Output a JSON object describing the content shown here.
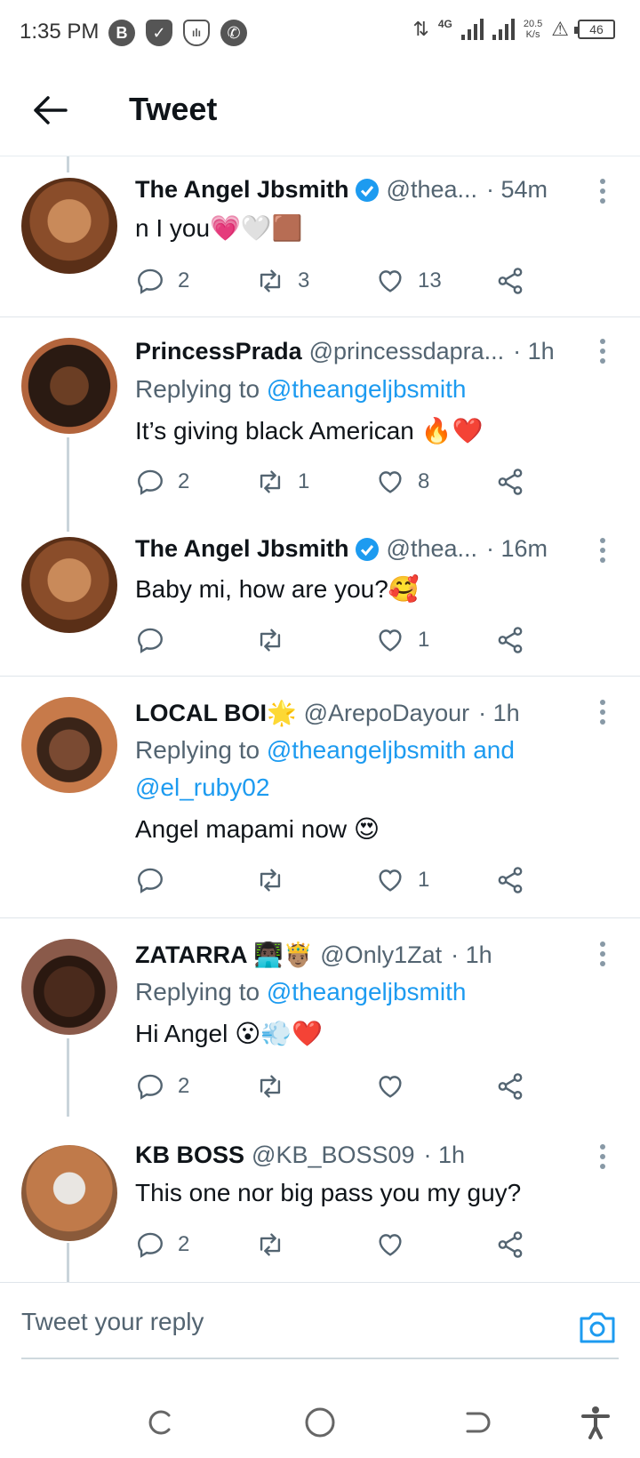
{
  "status_bar": {
    "time": "1:35 PM",
    "network": "4G",
    "speed_value": "20.5",
    "speed_unit": "K/s",
    "battery": "46"
  },
  "header": {
    "title": "Tweet"
  },
  "tweets": [
    {
      "name": "The Angel Jbsmith",
      "verified": true,
      "handle": "@thea...",
      "time": "· 54m",
      "replying_prefix": "",
      "replying_to": "",
      "text": "n I you💗🤍🟫",
      "replies": "2",
      "retweets": "3",
      "likes": "13"
    },
    {
      "name": "PrincessPrada",
      "verified": false,
      "handle": "@princessdapra...",
      "time": "· 1h",
      "replying_prefix": "Replying to ",
      "replying_to": "@theangeljbsmith",
      "text": "It’s giving black American 🔥❤️",
      "replies": "2",
      "retweets": "1",
      "likes": "8"
    },
    {
      "name": "The Angel Jbsmith",
      "verified": true,
      "handle": "@thea...",
      "time": "· 16m",
      "replying_prefix": "",
      "replying_to": "",
      "text": "Baby mi, how are you?🥰",
      "replies": "",
      "retweets": "",
      "likes": "1"
    },
    {
      "name": "LOCAL BOI🌟",
      "verified": false,
      "handle": "@ArepoDayour",
      "time": "· 1h",
      "replying_prefix": "Replying to ",
      "replying_to": "@theangeljbsmith and",
      "replying_to_2": "@el_ruby02",
      "text": "Angel mapami now 😍",
      "replies": "",
      "retweets": "",
      "likes": "1"
    },
    {
      "name": "ZATARRA 👨🏿‍💻🤴🏽",
      "verified": false,
      "handle": "@Only1Zat",
      "time": "· 1h",
      "replying_prefix": "Replying to ",
      "replying_to": "@theangeljbsmith",
      "text": "Hi Angel 😮💨❤️",
      "replies": "2",
      "retweets": "",
      "likes": ""
    },
    {
      "name": "KB BOSS",
      "verified": false,
      "handle": "@KB_BOSS09",
      "time": "· 1h",
      "replying_prefix": "",
      "replying_to": "",
      "text": "This one nor big pass you my guy?",
      "replies": "2",
      "retweets": "",
      "likes": ""
    }
  ],
  "reply_bar": {
    "placeholder": "Tweet your reply"
  },
  "colors": {
    "accent": "#1d9bf0",
    "text": "#0f1419",
    "muted": "#536471"
  }
}
